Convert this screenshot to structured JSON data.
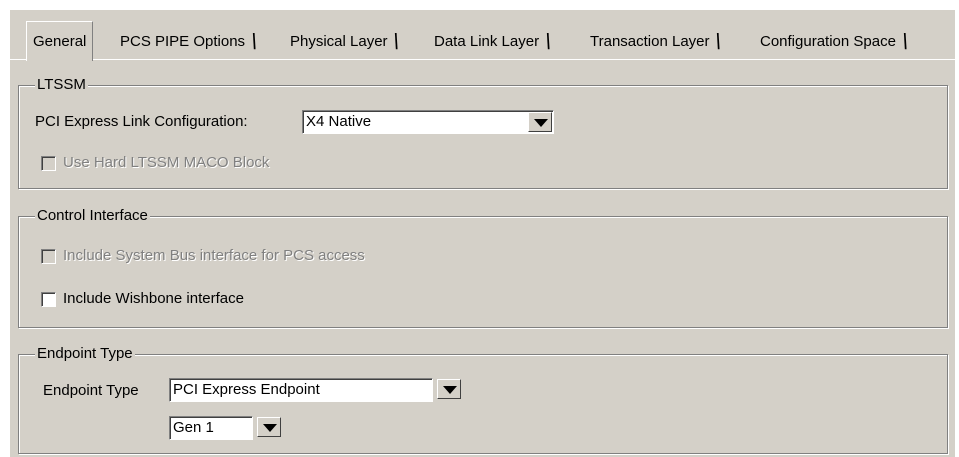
{
  "tabs": [
    {
      "label": "General",
      "selected": true
    },
    {
      "label": "PCS PIPE Options",
      "selected": false
    },
    {
      "label": "Physical Layer",
      "selected": false
    },
    {
      "label": "Data Link Layer",
      "selected": false
    },
    {
      "label": "Transaction Layer",
      "selected": false
    },
    {
      "label": "Configuration Space",
      "selected": false
    }
  ],
  "ltssm": {
    "legend": "LTSSM",
    "link_config_label": "PCI Express Link Configuration:",
    "link_config_value": "X4 Native",
    "hard_ltssm_label": "Use Hard LTSSM MACO Block",
    "hard_ltssm_checked": false,
    "hard_ltssm_enabled": false
  },
  "control_interface": {
    "legend": "Control Interface",
    "system_bus_label": "Include System Bus interface for PCS access",
    "system_bus_checked": false,
    "system_bus_enabled": false,
    "wishbone_label": "Include Wishbone interface",
    "wishbone_checked": false
  },
  "endpoint": {
    "legend": "Endpoint Type",
    "type_label": "Endpoint Type",
    "type_value": "PCI Express Endpoint",
    "gen_value": "Gen 1"
  }
}
